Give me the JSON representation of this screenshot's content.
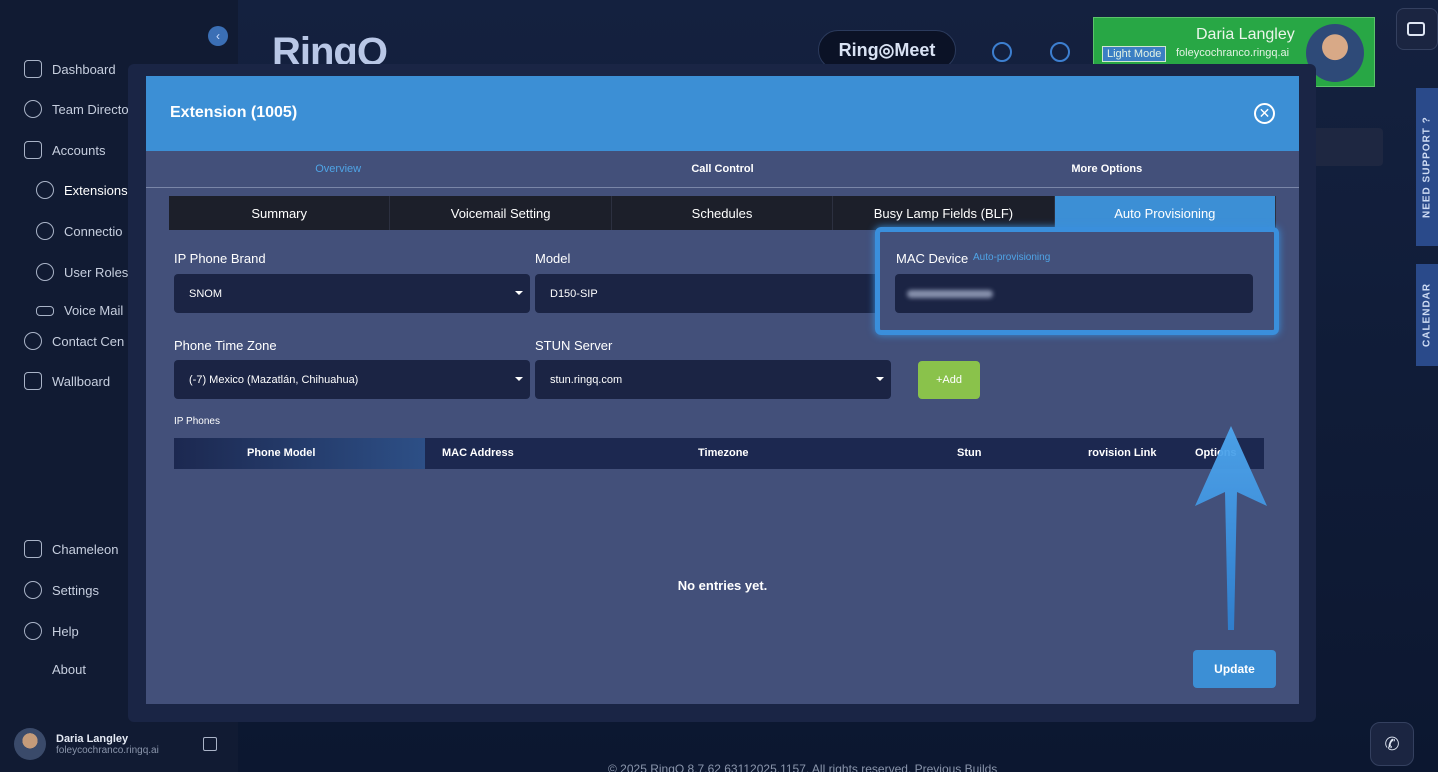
{
  "sidebar": {
    "items": [
      {
        "label": "Dashboard"
      },
      {
        "label": "Team Directo"
      },
      {
        "label": "Accounts"
      },
      {
        "label": "Extensions"
      },
      {
        "label": "Connectio"
      },
      {
        "label": "User Roles"
      },
      {
        "label": "Voice Mail"
      },
      {
        "label": "Contact Cen"
      },
      {
        "label": "Wallboard"
      },
      {
        "label": "Chameleon"
      },
      {
        "label": "Settings"
      },
      {
        "label": "Help"
      },
      {
        "label": "About"
      }
    ],
    "user": {
      "name": "Daria Langley",
      "email": "foleycochranco.ringq.ai"
    }
  },
  "header": {
    "logo": "RingQ",
    "ringmeet": "Ring◎Meet",
    "profile": {
      "name": "Daria Langley",
      "mode": "Light Mode",
      "email": "foleycochranco.ringq.ai"
    }
  },
  "side_tabs": {
    "support": "NEED SUPPORT ?",
    "calendar": "CALENDAR"
  },
  "footer": "© 2025 RingQ 8.7.62 63112025.1157. All rights reserved.   Previous Builds",
  "modal": {
    "title": "Extension (1005)",
    "top_tabs": [
      {
        "label": "Overview"
      },
      {
        "label": "Call Control"
      },
      {
        "label": "More Options"
      }
    ],
    "sub_tabs": [
      {
        "label": "Summary"
      },
      {
        "label": "Voicemail Setting"
      },
      {
        "label": "Schedules"
      },
      {
        "label": "Busy Lamp Fields (BLF)"
      },
      {
        "label": "Auto Provisioning"
      }
    ],
    "fields": {
      "brand": {
        "label": "IP Phone Brand",
        "value": "SNOM"
      },
      "model": {
        "label": "Model",
        "value": "D150-SIP"
      },
      "mac": {
        "label": "MAC Device",
        "sub": "Auto-provisioning"
      },
      "timezone": {
        "label": "Phone Time Zone",
        "value": "(-7) Mexico (Mazatlán, Chihuahua)"
      },
      "stun": {
        "label": "STUN Server",
        "value": "stun.ringq.com"
      }
    },
    "add_label": "+Add",
    "ip_phones_label": "IP Phones",
    "table": {
      "columns": [
        "Phone Model",
        "MAC Address",
        "Timezone",
        "Stun",
        "rovision Link",
        "Options"
      ]
    },
    "empty_text": "No entries yet.",
    "update_label": "Update"
  },
  "colors": {
    "accent": "#3c8fd5",
    "add": "#8ac24b",
    "profile": "#28a745"
  }
}
